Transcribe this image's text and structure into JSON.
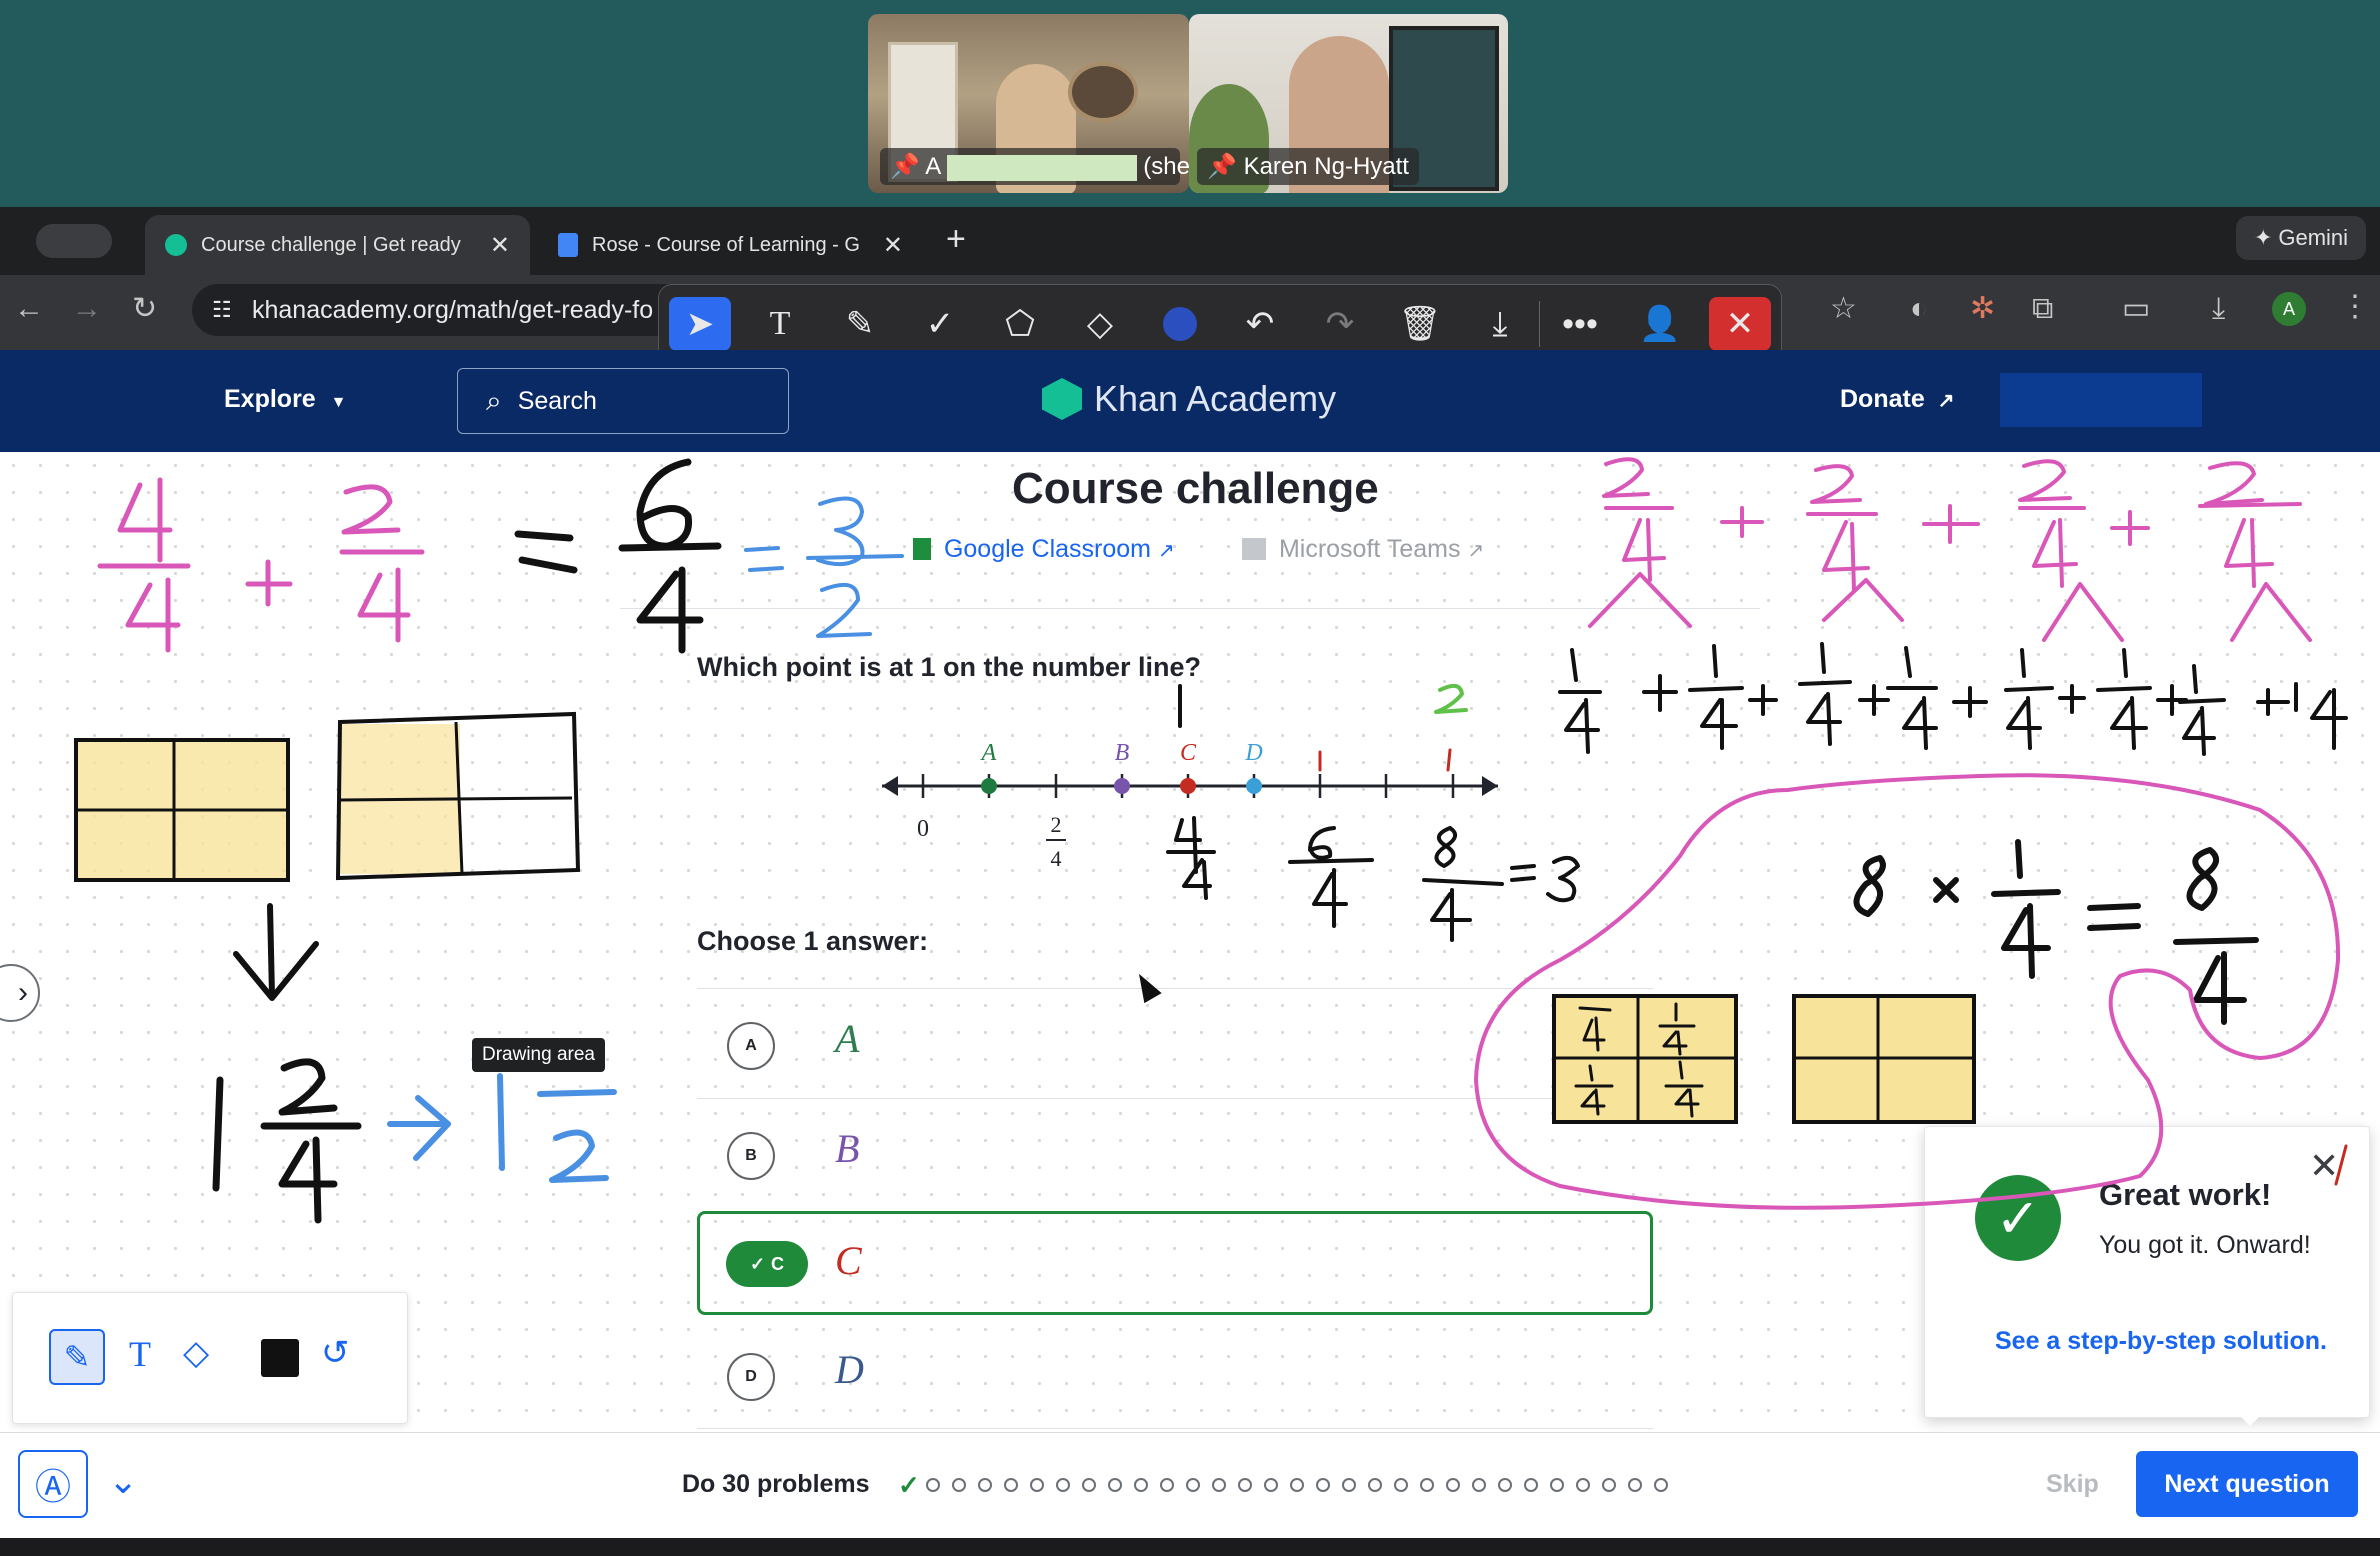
{
  "meeting": {
    "participants": [
      {
        "name": "A",
        "suffix": "(she..."
      },
      {
        "name": "Karen Ng-Hyatt"
      }
    ]
  },
  "browser": {
    "tabs": [
      {
        "title": "Course challenge | Get ready"
      },
      {
        "title": "Rose - Course of Learning - G"
      }
    ],
    "new_tab": "+",
    "gemini": "Gemini",
    "url": "khanacademy.org/math/get-ready-fo",
    "profile_initial": "A"
  },
  "khan": {
    "nav": {
      "explore": "Explore",
      "search": "Search",
      "brand": "Khan Academy",
      "donate": "Donate"
    },
    "title": "Course challenge",
    "google_classroom": "Google Classroom",
    "microsoft_teams": "Microsoft Teams",
    "question": "Which point is at 1 on the number line?",
    "choose": "Choose 1 answer:",
    "number_line": {
      "points": [
        {
          "label": "A",
          "color": "#1f7a40"
        },
        {
          "label": "B",
          "color": "#7854ab"
        },
        {
          "label": "C",
          "color": "#c42b21"
        },
        {
          "label": "D",
          "color": "#3a9fd6"
        }
      ],
      "tick_labels": [
        "0",
        "2",
        "4"
      ]
    },
    "options": [
      {
        "letter": "A",
        "label": "A",
        "color": "#2e7d4f"
      },
      {
        "letter": "B",
        "label": "B",
        "color": "#7854ab"
      },
      {
        "letter": "C",
        "label": "C",
        "color": "#c42b21",
        "selected": true
      },
      {
        "letter": "D",
        "label": "D",
        "color": "#3b5a8c"
      }
    ],
    "feedback": {
      "title": "Great work!",
      "message": "You got it. Onward!",
      "link": "See a step-by-step solution."
    },
    "footer": {
      "problems": "Do 30 problems",
      "skip": "Skip",
      "next": "Next question"
    },
    "tooltip": "Drawing area",
    "progress": {
      "total": 30,
      "completed": 1
    }
  },
  "colors": {
    "accent": "#1865f2",
    "nav": "#0a2a66",
    "correct": "#1e8a3a",
    "ink_pink": "#d957b8",
    "ink_blue": "#4a90e2"
  }
}
